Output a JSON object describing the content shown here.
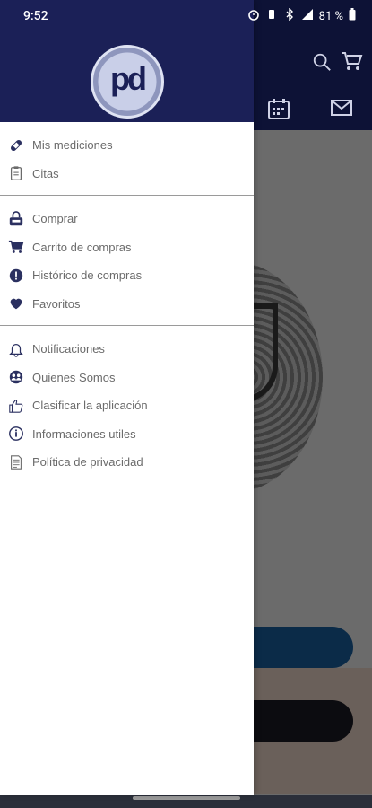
{
  "status": {
    "time": "9:52",
    "battery": "81 %"
  },
  "menu": {
    "sections": [
      {
        "items": [
          {
            "label": "Mis mediciones",
            "icon": "bandage-icon"
          },
          {
            "label": "Citas",
            "icon": "clipboard-icon"
          }
        ]
      },
      {
        "items": [
          {
            "label": "Comprar",
            "icon": "shop-icon"
          },
          {
            "label": "Carrito de compras",
            "icon": "cart-icon"
          },
          {
            "label": "Histórico de compras",
            "icon": "info-circle-icon"
          },
          {
            "label": "Favoritos",
            "icon": "heart-icon"
          }
        ]
      },
      {
        "items": [
          {
            "label": "Notificaciones",
            "icon": "bell-icon"
          },
          {
            "label": "Quienes Somos",
            "icon": "group-icon"
          },
          {
            "label": "Clasificar la aplicación",
            "icon": "thumb-up-icon"
          },
          {
            "label": "Informaciones utiles",
            "icon": "info-outline-icon"
          },
          {
            "label": "Política de privacidad",
            "icon": "document-icon"
          }
        ]
      }
    ]
  },
  "logo": {
    "text": "pd"
  },
  "colors": {
    "header": "#1b2057",
    "label": "#6b6b6b",
    "icon": "#2b3060"
  }
}
